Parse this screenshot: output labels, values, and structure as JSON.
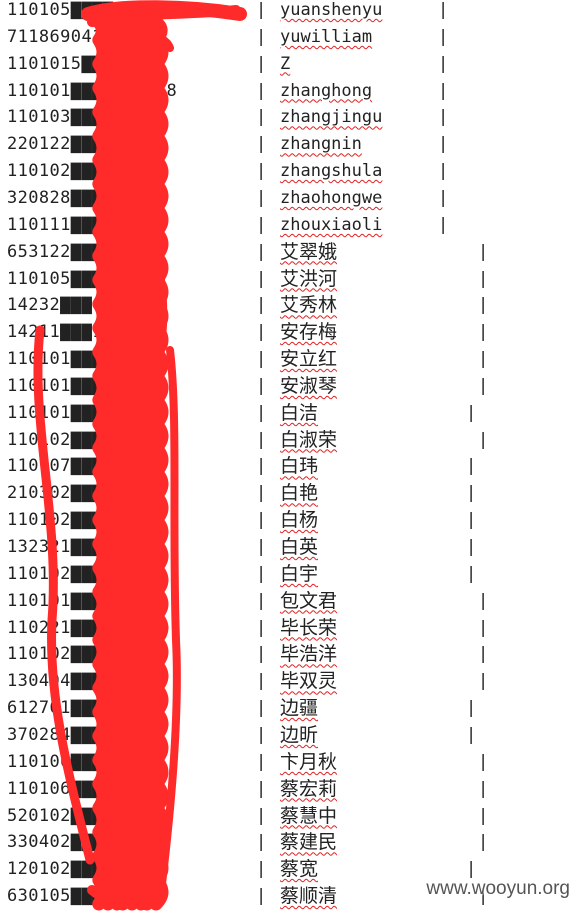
{
  "separator": "|",
  "rows": [
    {
      "id": "110105▇▇▇▇154x",
      "name": "yuanshenyu",
      "cjk": false,
      "end": 438
    },
    {
      "id": "711869041▇",
      "name": "yuwilliam",
      "cjk": false,
      "end": 438
    },
    {
      "id": "1101015▇▇▇10452",
      "name": "Z",
      "cjk": false,
      "end": 438
    },
    {
      "id": "110101▇▇▇8194048",
      "name": "zhanghong",
      "cjk": false,
      "end": 438
    },
    {
      "id": "110103▇▇▇231224",
      "name": "zhangjingu",
      "cjk": false,
      "end": 438
    },
    {
      "id": "220122▇▇▇065322",
      "name": "zhangnin",
      "cjk": false,
      "end": 438
    },
    {
      "id": "110102▇▇▇311949",
      "name": "zhangshula",
      "cjk": false,
      "end": 438
    },
    {
      "id": "320828▇▇▇301",
      "name": "zhaohongwe",
      "cjk": false,
      "end": 438
    },
    {
      "id": "110111▇▇▇110345",
      "name": "zhouxiaoli",
      "cjk": false,
      "end": 438
    },
    {
      "id": "653122▇▇▇060325",
      "name": "艾翠娥",
      "cjk": true,
      "end": 478
    },
    {
      "id": "110105▇▇▇137158",
      "name": "艾洪河",
      "cjk": true,
      "end": 478
    },
    {
      "id": "14232▇▇▇076",
      "name": "艾秀林",
      "cjk": true,
      "end": 478
    },
    {
      "id": "14211▇▇▇134",
      "name": "安存梅",
      "cjk": true,
      "end": 478
    },
    {
      "id": "110101▇▇▇253511",
      "name": "安立红",
      "cjk": true,
      "end": 478
    },
    {
      "id": "110101▇▇▇254x",
      "name": "安淑琴",
      "cjk": true,
      "end": 478
    },
    {
      "id": "110101▇▇▇36123",
      "name": "白洁",
      "cjk": true,
      "end": 466
    },
    {
      "id": "110102▇▇▇110844",
      "name": "白淑荣",
      "cjk": true,
      "end": 478
    },
    {
      "id": "110107▇▇▇230329",
      "name": "白玮",
      "cjk": true,
      "end": 466
    },
    {
      "id": "210302▇▇▇252144",
      "name": "白艳",
      "cjk": true,
      "end": 466
    },
    {
      "id": "110102▇▇▇001",
      "name": "白杨",
      "cjk": true,
      "end": 466
    },
    {
      "id": "132321▇▇▇031226",
      "name": "白英",
      "cjk": true,
      "end": 466
    },
    {
      "id": "110102▇▇▇30011",
      "name": "白宇",
      "cjk": true,
      "end": 466
    },
    {
      "id": "110101▇▇▇13421",
      "name": "包文君",
      "cjk": true,
      "end": 478
    },
    {
      "id": "110221▇▇▇53820",
      "name": "毕长荣",
      "cjk": true,
      "end": 478
    },
    {
      "id": "110102▇▇▇50033",
      "name": "毕浩洋",
      "cjk": true,
      "end": 478
    },
    {
      "id": "130404▇▇▇152X",
      "name": "毕双灵",
      "cjk": true,
      "end": 478
    },
    {
      "id": "612701▇▇▇46433",
      "name": "边疆",
      "cjk": true,
      "end": 466
    },
    {
      "id": "370284▇▇▇1042x",
      "name": "边昕",
      "cjk": true,
      "end": 466
    },
    {
      "id": "110106▇▇▇41247",
      "name": "卞月秋",
      "cjk": true,
      "end": 478
    },
    {
      "id": "110106▇▇▇314247",
      "name": "蔡宏莉",
      "cjk": true,
      "end": 478
    },
    {
      "id": "520102▇▇▇162",
      "name": "蔡慧中",
      "cjk": true,
      "end": 478
    },
    {
      "id": "330402▇▇▇150953",
      "name": "蔡建民",
      "cjk": true,
      "end": 478
    },
    {
      "id": "120102▇▇▇011410",
      "name": "蔡宽",
      "cjk": true,
      "end": 466
    },
    {
      "id": "630105▇▇▇022017",
      "name": "蔡顺清",
      "cjk": true,
      "end": 478
    }
  ],
  "watermark": "www.wooyun.org",
  "redaction_color": "#ff2a2a"
}
